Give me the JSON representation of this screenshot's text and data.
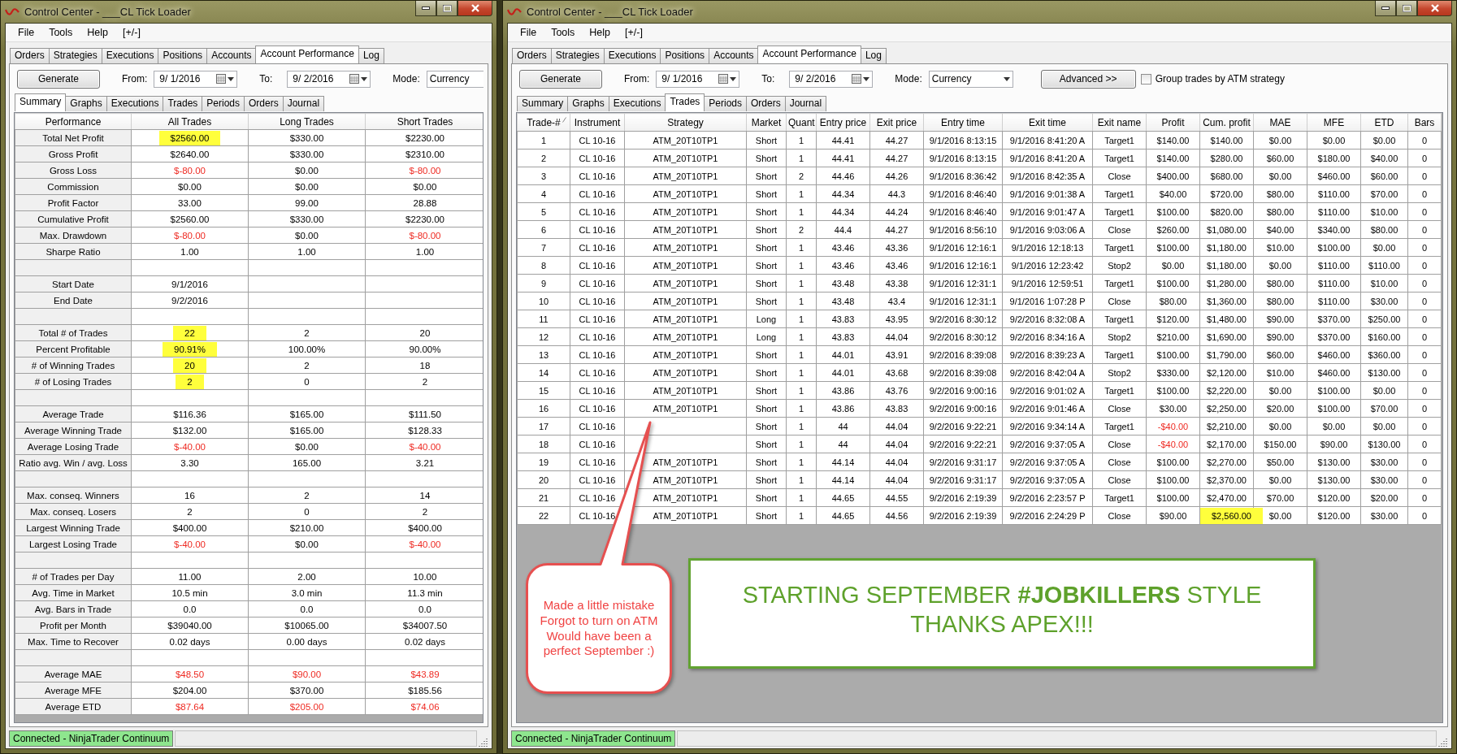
{
  "windows": [
    {
      "kind": "summary",
      "title": "Control Center - ___CL Tick Loader",
      "menu": [
        "File",
        "Tools",
        "Help",
        "[+/-]"
      ],
      "tabs": [
        {
          "label": "Orders",
          "selected": false
        },
        {
          "label": "Strategies",
          "selected": false
        },
        {
          "label": "Executions",
          "selected": false
        },
        {
          "label": "Positions",
          "selected": false
        },
        {
          "label": "Accounts",
          "selected": false
        },
        {
          "label": "Account Performance",
          "selected": true
        },
        {
          "label": "Log",
          "selected": false
        }
      ],
      "toolbar": {
        "generate": "Generate",
        "from_label": "From:",
        "from_value": "9/ 1/2016",
        "to_label": "To:",
        "to_value": "9/ 2/2016",
        "mode_label": "Mode:",
        "mode_value": "Currency"
      },
      "sub_tabs": [
        {
          "label": "Summary",
          "selected": true
        },
        {
          "label": "Graphs",
          "selected": false
        },
        {
          "label": "Executions",
          "selected": false
        },
        {
          "label": "Trades",
          "selected": false
        },
        {
          "label": "Periods",
          "selected": false
        },
        {
          "label": "Orders",
          "selected": false
        },
        {
          "label": "Journal",
          "selected": false
        }
      ],
      "table": {
        "columns": [
          {
            "label": "Performance",
            "sorted": false
          },
          {
            "label": "All Trades",
            "sorted": false
          },
          {
            "label": "Long Trades",
            "sorted": false
          },
          {
            "label": "Short Trades",
            "sorted": false
          }
        ],
        "rows": [
          {
            "kind": "data",
            "cells": [
              "Total Net Profit",
              {
                "text": "$2560.00",
                "highlight": true
              },
              "$330.00",
              "$2230.00"
            ]
          },
          {
            "kind": "data",
            "cells": [
              "Gross Profit",
              "$2640.00",
              "$330.00",
              "$2310.00"
            ]
          },
          {
            "kind": "data",
            "cells": [
              "Gross Loss",
              {
                "text": "$-80.00",
                "alert": true
              },
              "$0.00",
              {
                "text": "$-80.00",
                "alert": true
              }
            ]
          },
          {
            "kind": "data",
            "cells": [
              "Commission",
              "$0.00",
              "$0.00",
              "$0.00"
            ]
          },
          {
            "kind": "data",
            "cells": [
              "Profit Factor",
              "33.00",
              "99.00",
              "28.88"
            ]
          },
          {
            "kind": "data",
            "cells": [
              "Cumulative Profit",
              "$2560.00",
              "$330.00",
              "$2230.00"
            ]
          },
          {
            "kind": "data",
            "cells": [
              "Max. Drawdown",
              {
                "text": "$-80.00",
                "alert": true
              },
              "$0.00",
              {
                "text": "$-80.00",
                "alert": true
              }
            ]
          },
          {
            "kind": "data",
            "cells": [
              "Sharpe Ratio",
              "1.00",
              "1.00",
              "1.00"
            ]
          },
          {
            "kind": "spacer"
          },
          {
            "kind": "data",
            "cells": [
              "Start Date",
              "9/1/2016",
              null,
              null
            ]
          },
          {
            "kind": "data",
            "cells": [
              "End Date",
              "9/2/2016",
              null,
              null
            ]
          },
          {
            "kind": "spacer"
          },
          {
            "kind": "data",
            "cells": [
              "Total # of Trades",
              {
                "text": "22",
                "highlight": true
              },
              "2",
              "20"
            ]
          },
          {
            "kind": "data",
            "cells": [
              "Percent Profitable",
              {
                "text": "90.91%",
                "highlight": true
              },
              "100.00%",
              "90.00%"
            ]
          },
          {
            "kind": "data",
            "cells": [
              "# of Winning Trades",
              {
                "text": "20",
                "highlight": true
              },
              "2",
              "18"
            ]
          },
          {
            "kind": "data",
            "cells": [
              "# of Losing Trades",
              {
                "text": "2",
                "highlight": true
              },
              "0",
              "2"
            ]
          },
          {
            "kind": "spacer"
          },
          {
            "kind": "data",
            "cells": [
              "Average Trade",
              "$116.36",
              "$165.00",
              "$111.50"
            ]
          },
          {
            "kind": "data",
            "cells": [
              "Average Winning Trade",
              "$132.00",
              "$165.00",
              "$128.33"
            ]
          },
          {
            "kind": "data",
            "cells": [
              "Average Losing Trade",
              {
                "text": "$-40.00",
                "alert": true
              },
              "$0.00",
              {
                "text": "$-40.00",
                "alert": true
              }
            ]
          },
          {
            "kind": "data",
            "cells": [
              "Ratio avg. Win / avg. Loss",
              "3.30",
              "165.00",
              "3.21"
            ]
          },
          {
            "kind": "spacer"
          },
          {
            "kind": "data",
            "cells": [
              "Max. conseq. Winners",
              "16",
              "2",
              "14"
            ]
          },
          {
            "kind": "data",
            "cells": [
              "Max. conseq. Losers",
              "2",
              "0",
              "2"
            ]
          },
          {
            "kind": "data",
            "cells": [
              "Largest Winning Trade",
              "$400.00",
              "$210.00",
              "$400.00"
            ]
          },
          {
            "kind": "data",
            "cells": [
              "Largest Losing Trade",
              {
                "text": "$-40.00",
                "alert": true
              },
              "$0.00",
              {
                "text": "$-40.00",
                "alert": true
              }
            ]
          },
          {
            "kind": "spacer"
          },
          {
            "kind": "data",
            "cells": [
              "# of Trades per Day",
              "11.00",
              "2.00",
              "10.00"
            ]
          },
          {
            "kind": "data",
            "cells": [
              "Avg. Time in Market",
              "10.5 min",
              "3.0 min",
              "11.3 min"
            ]
          },
          {
            "kind": "data",
            "cells": [
              "Avg. Bars in Trade",
              "0.0",
              "0.0",
              "0.0"
            ]
          },
          {
            "kind": "data",
            "cells": [
              "Profit per Month",
              "$39040.00",
              "$10065.00",
              "$34007.50"
            ]
          },
          {
            "kind": "data",
            "cells": [
              "Max. Time to Recover",
              "0.02 days",
              "0.00 days",
              "0.02 days"
            ]
          },
          {
            "kind": "spacer"
          },
          {
            "kind": "data",
            "cells": [
              "Average MAE",
              {
                "text": "$48.50",
                "alert": true
              },
              {
                "text": "$90.00",
                "alert": true
              },
              {
                "text": "$43.89",
                "alert": true
              }
            ]
          },
          {
            "kind": "data",
            "cells": [
              "Average MFE",
              "$204.00",
              "$370.00",
              "$185.56"
            ]
          },
          {
            "kind": "data",
            "cells": [
              "Average ETD",
              {
                "text": "$87.64",
                "alert": true
              },
              {
                "text": "$205.00",
                "alert": true
              },
              {
                "text": "$74.06",
                "alert": true
              }
            ]
          }
        ]
      },
      "status": "Connected - NinjaTrader Continuum"
    },
    {
      "kind": "trades",
      "title": "Control Center - ___CL Tick Loader",
      "menu": [
        "File",
        "Tools",
        "Help",
        "[+/-]"
      ],
      "tabs": [
        {
          "label": "Orders",
          "selected": false
        },
        {
          "label": "Strategies",
          "selected": false
        },
        {
          "label": "Executions",
          "selected": false
        },
        {
          "label": "Positions",
          "selected": false
        },
        {
          "label": "Accounts",
          "selected": false
        },
        {
          "label": "Account Performance",
          "selected": true
        },
        {
          "label": "Log",
          "selected": false
        }
      ],
      "toolbar": {
        "generate": "Generate",
        "from_label": "From:",
        "from_value": "9/ 1/2016",
        "to_label": "To:",
        "to_value": "9/ 2/2016",
        "mode_label": "Mode:",
        "mode_value": "Currency",
        "advanced": "Advanced >>",
        "group_checkbox": {
          "label": "Group trades by ATM strategy",
          "checked": false
        }
      },
      "sub_tabs": [
        {
          "label": "Summary",
          "selected": false
        },
        {
          "label": "Graphs",
          "selected": false
        },
        {
          "label": "Executions",
          "selected": false
        },
        {
          "label": "Trades",
          "selected": true
        },
        {
          "label": "Periods",
          "selected": false
        },
        {
          "label": "Orders",
          "selected": false
        },
        {
          "label": "Journal",
          "selected": false
        }
      ],
      "table": {
        "columns": [
          {
            "label": "Trade-#",
            "sorted": true
          },
          {
            "label": "Instrument",
            "sorted": false
          },
          {
            "label": "Strategy",
            "sorted": false
          },
          {
            "label": "Market",
            "sorted": false
          },
          {
            "label": "Quant",
            "sorted": false
          },
          {
            "label": "Entry price",
            "sorted": false
          },
          {
            "label": "Exit price",
            "sorted": false
          },
          {
            "label": "Entry time",
            "sorted": false
          },
          {
            "label": "Exit time",
            "sorted": false
          },
          {
            "label": "Exit name",
            "sorted": false
          },
          {
            "label": "Profit",
            "sorted": false
          },
          {
            "label": "Cum. profit",
            "sorted": false
          },
          {
            "label": "MAE",
            "sorted": false
          },
          {
            "label": "MFE",
            "sorted": false
          },
          {
            "label": "ETD",
            "sorted": false
          },
          {
            "label": "Bars",
            "sorted": false
          }
        ],
        "rows": [
          {
            "kind": "data",
            "cells": [
              "1",
              "CL 10-16",
              "ATM_20T10TP1",
              "Short",
              "1",
              "44.41",
              "44.27",
              "9/1/2016 8:13:15",
              "9/1/2016 8:41:20 A",
              "Target1",
              "$140.00",
              "$140.00",
              "$0.00",
              "$0.00",
              "$0.00",
              "0"
            ]
          },
          {
            "kind": "data",
            "cells": [
              "2",
              "CL 10-16",
              "ATM_20T10TP1",
              "Short",
              "1",
              "44.41",
              "44.27",
              "9/1/2016 8:13:15",
              "9/1/2016 8:41:20 A",
              "Target1",
              "$140.00",
              "$280.00",
              "$60.00",
              "$180.00",
              "$40.00",
              "0"
            ]
          },
          {
            "kind": "data",
            "cells": [
              "3",
              "CL 10-16",
              "ATM_20T10TP1",
              "Short",
              "2",
              "44.46",
              "44.26",
              "9/1/2016 8:36:42",
              "9/1/2016 8:42:35 A",
              "Close",
              "$400.00",
              "$680.00",
              "$0.00",
              "$460.00",
              "$60.00",
              "0"
            ]
          },
          {
            "kind": "data",
            "cells": [
              "4",
              "CL 10-16",
              "ATM_20T10TP1",
              "Short",
              "1",
              "44.34",
              "44.3",
              "9/1/2016 8:46:40",
              "9/1/2016 9:01:38 A",
              "Target1",
              "$40.00",
              "$720.00",
              "$80.00",
              "$110.00",
              "$70.00",
              "0"
            ]
          },
          {
            "kind": "data",
            "cells": [
              "5",
              "CL 10-16",
              "ATM_20T10TP1",
              "Short",
              "1",
              "44.34",
              "44.24",
              "9/1/2016 8:46:40",
              "9/1/2016 9:01:47 A",
              "Target1",
              "$100.00",
              "$820.00",
              "$80.00",
              "$110.00",
              "$10.00",
              "0"
            ]
          },
          {
            "kind": "data",
            "cells": [
              "6",
              "CL 10-16",
              "ATM_20T10TP1",
              "Short",
              "2",
              "44.4",
              "44.27",
              "9/1/2016 8:56:10",
              "9/1/2016 9:03:06 A",
              "Close",
              "$260.00",
              "$1,080.00",
              "$40.00",
              "$340.00",
              "$80.00",
              "0"
            ]
          },
          {
            "kind": "data",
            "cells": [
              "7",
              "CL 10-16",
              "ATM_20T10TP1",
              "Short",
              "1",
              "43.46",
              "43.36",
              "9/1/2016 12:16:1",
              "9/1/2016 12:18:13",
              "Target1",
              "$100.00",
              "$1,180.00",
              "$10.00",
              "$100.00",
              "$0.00",
              "0"
            ]
          },
          {
            "kind": "data",
            "cells": [
              "8",
              "CL 10-16",
              "ATM_20T10TP1",
              "Short",
              "1",
              "43.46",
              "43.46",
              "9/1/2016 12:16:1",
              "9/1/2016 12:23:42",
              "Stop2",
              "$0.00",
              "$1,180.00",
              "$0.00",
              "$110.00",
              "$110.00",
              "0"
            ]
          },
          {
            "kind": "data",
            "cells": [
              "9",
              "CL 10-16",
              "ATM_20T10TP1",
              "Short",
              "1",
              "43.48",
              "43.38",
              "9/1/2016 12:31:1",
              "9/1/2016 12:59:51",
              "Target1",
              "$100.00",
              "$1,280.00",
              "$80.00",
              "$110.00",
              "$10.00",
              "0"
            ]
          },
          {
            "kind": "data",
            "cells": [
              "10",
              "CL 10-16",
              "ATM_20T10TP1",
              "Short",
              "1",
              "43.48",
              "43.4",
              "9/1/2016 12:31:1",
              "9/1/2016 1:07:28 P",
              "Close",
              "$80.00",
              "$1,360.00",
              "$80.00",
              "$110.00",
              "$30.00",
              "0"
            ]
          },
          {
            "kind": "data",
            "cells": [
              "11",
              "CL 10-16",
              "ATM_20T10TP1",
              "Long",
              "1",
              "43.83",
              "43.95",
              "9/2/2016 8:30:12",
              "9/2/2016 8:32:08 A",
              "Target1",
              "$120.00",
              "$1,480.00",
              "$90.00",
              "$370.00",
              "$250.00",
              "0"
            ]
          },
          {
            "kind": "data",
            "cells": [
              "12",
              "CL 10-16",
              "ATM_20T10TP1",
              "Long",
              "1",
              "43.83",
              "44.04",
              "9/2/2016 8:30:12",
              "9/2/2016 8:34:16 A",
              "Stop2",
              "$210.00",
              "$1,690.00",
              "$90.00",
              "$370.00",
              "$160.00",
              "0"
            ]
          },
          {
            "kind": "data",
            "cells": [
              "13",
              "CL 10-16",
              "ATM_20T10TP1",
              "Short",
              "1",
              "44.01",
              "43.91",
              "9/2/2016 8:39:08",
              "9/2/2016 8:39:23 A",
              "Target1",
              "$100.00",
              "$1,790.00",
              "$60.00",
              "$460.00",
              "$360.00",
              "0"
            ]
          },
          {
            "kind": "data",
            "cells": [
              "14",
              "CL 10-16",
              "ATM_20T10TP1",
              "Short",
              "1",
              "44.01",
              "43.68",
              "9/2/2016 8:39:08",
              "9/2/2016 8:42:04 A",
              "Stop2",
              "$330.00",
              "$2,120.00",
              "$10.00",
              "$460.00",
              "$130.00",
              "0"
            ]
          },
          {
            "kind": "data",
            "cells": [
              "15",
              "CL 10-16",
              "ATM_20T10TP1",
              "Short",
              "1",
              "43.86",
              "43.76",
              "9/2/2016 9:00:16",
              "9/2/2016 9:01:02 A",
              "Target1",
              "$100.00",
              "$2,220.00",
              "$0.00",
              "$100.00",
              "$0.00",
              "0"
            ]
          },
          {
            "kind": "data",
            "cells": [
              "16",
              "CL 10-16",
              "ATM_20T10TP1",
              "Short",
              "1",
              "43.86",
              "43.83",
              "9/2/2016 9:00:16",
              "9/2/2016 9:01:46 A",
              "Close",
              "$30.00",
              "$2,250.00",
              "$20.00",
              "$100.00",
              "$70.00",
              "0"
            ]
          },
          {
            "kind": "data",
            "cells": [
              "17",
              "CL 10-16",
              null,
              "Short",
              "1",
              "44",
              "44.04",
              "9/2/2016 9:22:21",
              "9/2/2016 9:34:14 A",
              "Target1",
              {
                "text": "-$40.00",
                "alert": true
              },
              "$2,210.00",
              "$0.00",
              "$0.00",
              "$0.00",
              "0"
            ]
          },
          {
            "kind": "data",
            "cells": [
              "18",
              "CL 10-16",
              null,
              "Short",
              "1",
              "44",
              "44.04",
              "9/2/2016 9:22:21",
              "9/2/2016 9:37:05 A",
              "Close",
              {
                "text": "-$40.00",
                "alert": true
              },
              "$2,170.00",
              "$150.00",
              "$90.00",
              "$130.00",
              "0"
            ]
          },
          {
            "kind": "data",
            "cells": [
              "19",
              "CL 10-16",
              "ATM_20T10TP1",
              "Short",
              "1",
              "44.14",
              "44.04",
              "9/2/2016 9:31:17",
              "9/2/2016 9:37:05 A",
              "Close",
              "$100.00",
              "$2,270.00",
              "$50.00",
              "$130.00",
              "$30.00",
              "0"
            ]
          },
          {
            "kind": "data",
            "cells": [
              "20",
              "CL 10-16",
              "ATM_20T10TP1",
              "Short",
              "1",
              "44.14",
              "44.04",
              "9/2/2016 9:31:17",
              "9/2/2016 9:37:05 A",
              "Close",
              "$100.00",
              "$2,370.00",
              "$0.00",
              "$130.00",
              "$30.00",
              "0"
            ]
          },
          {
            "kind": "data",
            "cells": [
              "21",
              "CL 10-16",
              "ATM_20T10TP1",
              "Short",
              "1",
              "44.65",
              "44.55",
              "9/2/2016 2:19:39",
              "9/2/2016 2:23:57 P",
              "Target1",
              "$100.00",
              "$2,470.00",
              "$70.00",
              "$120.00",
              "$20.00",
              "0"
            ]
          },
          {
            "kind": "data",
            "cells": [
              "22",
              "CL 10-16",
              "ATM_20T10TP1",
              "Short",
              "1",
              "44.65",
              "44.56",
              "9/2/2016 2:19:39",
              "9/2/2016 2:24:29 P",
              "Close",
              "$90.00",
              {
                "text": "$2,560.00",
                "highlight": true
              },
              "$0.00",
              "$120.00",
              "$30.00",
              "0"
            ]
          }
        ]
      },
      "annotations": {
        "callout": [
          "Made a little mistake",
          "Forgot to turn on ATM",
          "Would have been a",
          "perfect September :)"
        ],
        "banner": [
          "STARTING SEPTEMBER **#JOBKILLERS** STYLE",
          "THANKS APEX!!!"
        ]
      },
      "status": "Connected - NinjaTrader Continuum"
    }
  ]
}
